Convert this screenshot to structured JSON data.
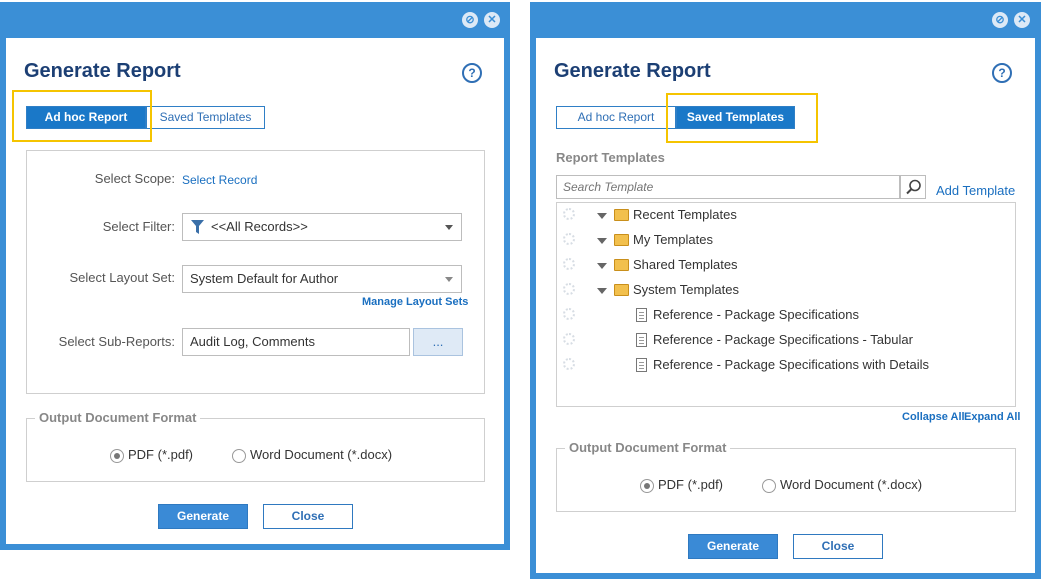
{
  "left_dialog": {
    "title": "Generate Report",
    "tabs": [
      {
        "label": "Ad hoc Report",
        "active": true
      },
      {
        "label": "Saved Templates",
        "active": false
      }
    ],
    "scope": {
      "label": "Select Scope:",
      "link": "Select Record"
    },
    "filter": {
      "label": "Select Filter:",
      "value": "<<All Records>>"
    },
    "layout_set": {
      "label": "Select Layout Set:",
      "value": "System Default for Author",
      "manage_link": "Manage Layout Sets"
    },
    "sub_reports": {
      "label": "Select Sub-Reports:",
      "value": "Audit Log, Comments",
      "browse": "..."
    },
    "output_format": {
      "legend": "Output Document Format",
      "options": [
        {
          "label": "PDF (*.pdf)",
          "selected": true
        },
        {
          "label": "Word Document (*.docx)",
          "selected": false
        }
      ]
    },
    "buttons": {
      "generate": "Generate",
      "close": "Close"
    }
  },
  "right_dialog": {
    "title": "Generate Report",
    "tabs": [
      {
        "label": "Ad hoc Report",
        "active": false
      },
      {
        "label": "Saved Templates",
        "active": true
      }
    ],
    "section_title": "Report Templates",
    "search_placeholder": "Search Template",
    "add_template": "Add Template",
    "tree": [
      {
        "label": "Recent Templates",
        "type": "folder"
      },
      {
        "label": "My Templates",
        "type": "folder"
      },
      {
        "label": "Shared Templates",
        "type": "folder"
      },
      {
        "label": "System Templates",
        "type": "folder"
      },
      {
        "label": "Reference - Package Specifications",
        "type": "template"
      },
      {
        "label": "Reference - Package Specifications - Tabular",
        "type": "template"
      },
      {
        "label": "Reference - Package Specifications with Details",
        "type": "template"
      }
    ],
    "collapse_all": "Collapse All",
    "expand_all": "Expand All",
    "output_format": {
      "legend": "Output Document Format",
      "options": [
        {
          "label": "PDF (*.pdf)",
          "selected": true
        },
        {
          "label": "Word Document (*.docx)",
          "selected": false
        }
      ]
    },
    "buttons": {
      "generate": "Generate",
      "close": "Close"
    }
  },
  "icons": {
    "minimize": "minimize-icon",
    "close": "close-icon",
    "help": "help-icon",
    "filter": "filter-icon",
    "search": "search-icon",
    "gear": "gear-icon",
    "folder": "folder-icon",
    "document": "document-icon"
  },
  "colors": {
    "frame": "#3b8fd6",
    "active_tab": "#1a78c8",
    "title": "#1c3f74",
    "highlight": "#f5c400",
    "link": "#1a6fc0"
  }
}
